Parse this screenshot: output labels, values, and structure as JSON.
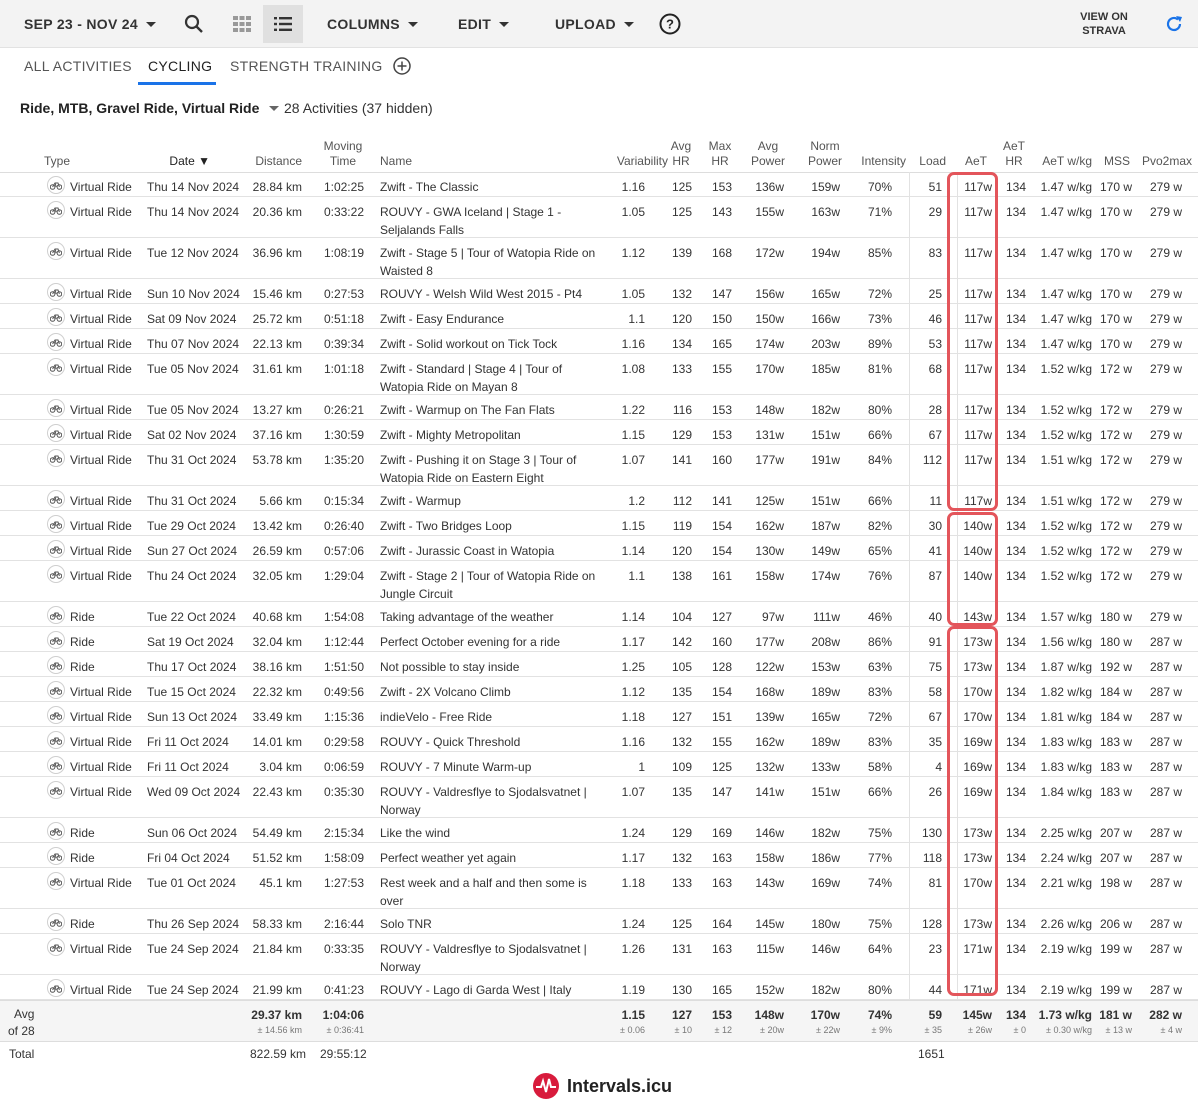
{
  "toolbar": {
    "date_range": "SEP 23 - NOV 24",
    "columns": "COLUMNS",
    "edit": "EDIT",
    "upload": "UPLOAD",
    "view_on_strava": "VIEW ON STRAVA",
    "active_view": "list"
  },
  "tabs": [
    "ALL ACTIVITIES",
    "CYCLING",
    "STRENGTH TRAINING"
  ],
  "active_tab": "CYCLING",
  "filter": {
    "types": "Ride, MTB, Gravel Ride, Virtual Ride",
    "count": "28 Activities (37 hidden)"
  },
  "columns": {
    "type": "Type",
    "date": "Date",
    "distance": "Distance",
    "moving_time": "Moving Time",
    "name": "Name",
    "variability": "Variability",
    "avg_hr": "Avg HR",
    "max_hr": "Max HR",
    "avg_power": "Avg Power",
    "norm_power": "Norm Power",
    "intensity": "Intensity",
    "load": "Load",
    "aet": "AeT",
    "aet_hr": "AeT HR",
    "aet_wkg": "AeT w/kg",
    "mss": "MSS",
    "pvo2max": "Pvo2max"
  },
  "rows": [
    {
      "type": "Virtual Ride",
      "date": "Thu 14 Nov 2024",
      "distance": "28.84 km",
      "time": "1:02:25",
      "name": "Zwift - The Classic",
      "var": "1.16",
      "avghr": "125",
      "maxhr": "153",
      "avgp": "136w",
      "normp": "159w",
      "int": "70%",
      "load": "51",
      "aet": "117w",
      "aethr": "134",
      "wkg": "1.47 w/kg",
      "mss": "170 w",
      "pvo": "279 w"
    },
    {
      "type": "Virtual Ride",
      "date": "Thu 14 Nov 2024",
      "distance": "20.36 km",
      "time": "0:33:22",
      "name": "ROUVY - GWA Iceland | Stage 1 - Seljalands Falls",
      "var": "1.05",
      "avghr": "125",
      "maxhr": "143",
      "avgp": "155w",
      "normp": "163w",
      "int": "71%",
      "load": "29",
      "aet": "117w",
      "aethr": "134",
      "wkg": "1.47 w/kg",
      "mss": "170 w",
      "pvo": "279 w"
    },
    {
      "type": "Virtual Ride",
      "date": "Tue 12 Nov 2024",
      "distance": "36.96 km",
      "time": "1:08:19",
      "name": "Zwift - Stage 5 | Tour of Watopia Ride on Waisted 8",
      "var": "1.12",
      "avghr": "139",
      "maxhr": "168",
      "avgp": "172w",
      "normp": "194w",
      "int": "85%",
      "load": "83",
      "aet": "117w",
      "aethr": "134",
      "wkg": "1.47 w/kg",
      "mss": "170 w",
      "pvo": "279 w"
    },
    {
      "type": "Virtual Ride",
      "date": "Sun 10 Nov 2024",
      "distance": "15.46 km",
      "time": "0:27:53",
      "name": "ROUVY - Welsh Wild West 2015 - Pt4",
      "var": "1.05",
      "avghr": "132",
      "maxhr": "147",
      "avgp": "156w",
      "normp": "165w",
      "int": "72%",
      "load": "25",
      "aet": "117w",
      "aethr": "134",
      "wkg": "1.47 w/kg",
      "mss": "170 w",
      "pvo": "279 w"
    },
    {
      "type": "Virtual Ride",
      "date": "Sat 09 Nov 2024",
      "distance": "25.72 km",
      "time": "0:51:18",
      "name": "Zwift - Easy Endurance",
      "var": "1.1",
      "avghr": "120",
      "maxhr": "150",
      "avgp": "150w",
      "normp": "166w",
      "int": "73%",
      "load": "46",
      "aet": "117w",
      "aethr": "134",
      "wkg": "1.47 w/kg",
      "mss": "170 w",
      "pvo": "279 w"
    },
    {
      "type": "Virtual Ride",
      "date": "Thu 07 Nov 2024",
      "distance": "22.13 km",
      "time": "0:39:34",
      "name": "Zwift - Solid workout on Tick Tock",
      "var": "1.16",
      "avghr": "134",
      "maxhr": "165",
      "avgp": "174w",
      "normp": "203w",
      "int": "89%",
      "load": "53",
      "aet": "117w",
      "aethr": "134",
      "wkg": "1.47 w/kg",
      "mss": "170 w",
      "pvo": "279 w"
    },
    {
      "type": "Virtual Ride",
      "date": "Tue 05 Nov 2024",
      "distance": "31.61 km",
      "time": "1:01:18",
      "name": "Zwift - Standard | Stage 4 | Tour of Watopia Ride on Mayan 8",
      "var": "1.08",
      "avghr": "133",
      "maxhr": "155",
      "avgp": "170w",
      "normp": "185w",
      "int": "81%",
      "load": "68",
      "aet": "117w",
      "aethr": "134",
      "wkg": "1.52 w/kg",
      "mss": "172 w",
      "pvo": "279 w"
    },
    {
      "type": "Virtual Ride",
      "date": "Tue 05 Nov 2024",
      "distance": "13.27 km",
      "time": "0:26:21",
      "name": "Zwift - Warmup on The Fan Flats",
      "var": "1.22",
      "avghr": "116",
      "maxhr": "153",
      "avgp": "148w",
      "normp": "182w",
      "int": "80%",
      "load": "28",
      "aet": "117w",
      "aethr": "134",
      "wkg": "1.52 w/kg",
      "mss": "172 w",
      "pvo": "279 w"
    },
    {
      "type": "Virtual Ride",
      "date": "Sat 02 Nov 2024",
      "distance": "37.16 km",
      "time": "1:30:59",
      "name": "Zwift - Mighty Metropolitan",
      "var": "1.15",
      "avghr": "129",
      "maxhr": "153",
      "avgp": "131w",
      "normp": "151w",
      "int": "66%",
      "load": "67",
      "aet": "117w",
      "aethr": "134",
      "wkg": "1.52 w/kg",
      "mss": "172 w",
      "pvo": "279 w"
    },
    {
      "type": "Virtual Ride",
      "date": "Thu 31 Oct 2024",
      "distance": "53.78 km",
      "time": "1:35:20",
      "name": "Zwift - Pushing it on Stage 3 | Tour of Watopia Ride on Eastern Eight",
      "var": "1.07",
      "avghr": "141",
      "maxhr": "160",
      "avgp": "177w",
      "normp": "191w",
      "int": "84%",
      "load": "112",
      "aet": "117w",
      "aethr": "134",
      "wkg": "1.51 w/kg",
      "mss": "172 w",
      "pvo": "279 w"
    },
    {
      "type": "Virtual Ride",
      "date": "Thu 31 Oct 2024",
      "distance": "5.66 km",
      "time": "0:15:34",
      "name": "Zwift - Warmup",
      "var": "1.2",
      "avghr": "112",
      "maxhr": "141",
      "avgp": "125w",
      "normp": "151w",
      "int": "66%",
      "load": "11",
      "aet": "117w",
      "aethr": "134",
      "wkg": "1.51 w/kg",
      "mss": "172 w",
      "pvo": "279 w"
    },
    {
      "type": "Virtual Ride",
      "date": "Tue 29 Oct 2024",
      "distance": "13.42 km",
      "time": "0:26:40",
      "name": "Zwift - Two Bridges Loop",
      "var": "1.15",
      "avghr": "119",
      "maxhr": "154",
      "avgp": "162w",
      "normp": "187w",
      "int": "82%",
      "load": "30",
      "aet": "140w",
      "aethr": "134",
      "wkg": "1.52 w/kg",
      "mss": "172 w",
      "pvo": "279 w"
    },
    {
      "type": "Virtual Ride",
      "date": "Sun 27 Oct 2024",
      "distance": "26.59 km",
      "time": "0:57:06",
      "name": "Zwift - Jurassic Coast in Watopia",
      "var": "1.14",
      "avghr": "120",
      "maxhr": "154",
      "avgp": "130w",
      "normp": "149w",
      "int": "65%",
      "load": "41",
      "aet": "140w",
      "aethr": "134",
      "wkg": "1.52 w/kg",
      "mss": "172 w",
      "pvo": "279 w"
    },
    {
      "type": "Virtual Ride",
      "date": "Thu 24 Oct 2024",
      "distance": "32.05 km",
      "time": "1:29:04",
      "name": "Zwift - Stage 2 | Tour of Watopia Ride on Jungle Circuit",
      "var": "1.1",
      "avghr": "138",
      "maxhr": "161",
      "avgp": "158w",
      "normp": "174w",
      "int": "76%",
      "load": "87",
      "aet": "140w",
      "aethr": "134",
      "wkg": "1.52 w/kg",
      "mss": "172 w",
      "pvo": "279 w"
    },
    {
      "type": "Ride",
      "date": "Tue 22 Oct 2024",
      "distance": "40.68 km",
      "time": "1:54:08",
      "name": "Taking advantage of the weather",
      "var": "1.14",
      "avghr": "104",
      "maxhr": "127",
      "avgp": "97w",
      "normp": "111w",
      "int": "46%",
      "load": "40",
      "aet": "143w",
      "aethr": "134",
      "wkg": "1.57 w/kg",
      "mss": "180 w",
      "pvo": "279 w"
    },
    {
      "type": "Ride",
      "date": "Sat 19 Oct 2024",
      "distance": "32.04 km",
      "time": "1:12:44",
      "name": "Perfect October evening for a ride",
      "var": "1.17",
      "avghr": "142",
      "maxhr": "160",
      "avgp": "177w",
      "normp": "208w",
      "int": "86%",
      "load": "91",
      "aet": "173w",
      "aethr": "134",
      "wkg": "1.56 w/kg",
      "mss": "180 w",
      "pvo": "287 w"
    },
    {
      "type": "Ride",
      "date": "Thu 17 Oct 2024",
      "distance": "38.16 km",
      "time": "1:51:50",
      "name": "Not possible to stay inside",
      "var": "1.25",
      "avghr": "105",
      "maxhr": "128",
      "avgp": "122w",
      "normp": "153w",
      "int": "63%",
      "load": "75",
      "aet": "173w",
      "aethr": "134",
      "wkg": "1.87 w/kg",
      "mss": "192 w",
      "pvo": "287 w"
    },
    {
      "type": "Virtual Ride",
      "date": "Tue 15 Oct 2024",
      "distance": "22.32 km",
      "time": "0:49:56",
      "name": "Zwift - 2X Volcano Climb",
      "var": "1.12",
      "avghr": "135",
      "maxhr": "154",
      "avgp": "168w",
      "normp": "189w",
      "int": "83%",
      "load": "58",
      "aet": "170w",
      "aethr": "134",
      "wkg": "1.82 w/kg",
      "mss": "184 w",
      "pvo": "287 w"
    },
    {
      "type": "Virtual Ride",
      "date": "Sun 13 Oct 2024",
      "distance": "33.49 km",
      "time": "1:15:36",
      "name": "indieVelo - Free Ride",
      "var": "1.18",
      "avghr": "127",
      "maxhr": "151",
      "avgp": "139w",
      "normp": "165w",
      "int": "72%",
      "load": "67",
      "aet": "170w",
      "aethr": "134",
      "wkg": "1.81 w/kg",
      "mss": "184 w",
      "pvo": "287 w"
    },
    {
      "type": "Virtual Ride",
      "date": "Fri 11 Oct 2024",
      "distance": "14.01 km",
      "time": "0:29:58",
      "name": "ROUVY - Quick Threshold",
      "var": "1.16",
      "avghr": "132",
      "maxhr": "155",
      "avgp": "162w",
      "normp": "189w",
      "int": "83%",
      "load": "35",
      "aet": "169w",
      "aethr": "134",
      "wkg": "1.83 w/kg",
      "mss": "183 w",
      "pvo": "287 w"
    },
    {
      "type": "Virtual Ride",
      "date": "Fri 11 Oct 2024",
      "distance": "3.04 km",
      "time": "0:06:59",
      "name": "ROUVY - 7 Minute Warm-up",
      "var": "1",
      "avghr": "109",
      "maxhr": "125",
      "avgp": "132w",
      "normp": "133w",
      "int": "58%",
      "load": "4",
      "aet": "169w",
      "aethr": "134",
      "wkg": "1.83 w/kg",
      "mss": "183 w",
      "pvo": "287 w"
    },
    {
      "type": "Virtual Ride",
      "date": "Wed 09 Oct 2024",
      "distance": "22.43 km",
      "time": "0:35:30",
      "name": "ROUVY - Valdresflye to Sjodalsvatnet | Norway",
      "var": "1.07",
      "avghr": "135",
      "maxhr": "147",
      "avgp": "141w",
      "normp": "151w",
      "int": "66%",
      "load": "26",
      "aet": "169w",
      "aethr": "134",
      "wkg": "1.84 w/kg",
      "mss": "183 w",
      "pvo": "287 w"
    },
    {
      "type": "Ride",
      "date": "Sun 06 Oct 2024",
      "distance": "54.49 km",
      "time": "2:15:34",
      "name": "Like the wind",
      "var": "1.24",
      "avghr": "129",
      "maxhr": "169",
      "avgp": "146w",
      "normp": "182w",
      "int": "75%",
      "load": "130",
      "aet": "173w",
      "aethr": "134",
      "wkg": "2.25 w/kg",
      "mss": "207 w",
      "pvo": "287 w"
    },
    {
      "type": "Ride",
      "date": "Fri 04 Oct 2024",
      "distance": "51.52 km",
      "time": "1:58:09",
      "name": "Perfect weather yet again",
      "var": "1.17",
      "avghr": "132",
      "maxhr": "163",
      "avgp": "158w",
      "normp": "186w",
      "int": "77%",
      "load": "118",
      "aet": "173w",
      "aethr": "134",
      "wkg": "2.24 w/kg",
      "mss": "207 w",
      "pvo": "287 w"
    },
    {
      "type": "Virtual Ride",
      "date": "Tue 01 Oct 2024",
      "distance": "45.1 km",
      "time": "1:27:53",
      "name": "Rest week and a half and then some is over",
      "var": "1.18",
      "avghr": "133",
      "maxhr": "163",
      "avgp": "143w",
      "normp": "169w",
      "int": "74%",
      "load": "81",
      "aet": "170w",
      "aethr": "134",
      "wkg": "2.21 w/kg",
      "mss": "198 w",
      "pvo": "287 w"
    },
    {
      "type": "Ride",
      "date": "Thu 26 Sep 2024",
      "distance": "58.33 km",
      "time": "2:16:44",
      "name": "Solo TNR",
      "var": "1.24",
      "avghr": "125",
      "maxhr": "164",
      "avgp": "145w",
      "normp": "180w",
      "int": "75%",
      "load": "128",
      "aet": "173w",
      "aethr": "134",
      "wkg": "2.26 w/kg",
      "mss": "206 w",
      "pvo": "287 w"
    },
    {
      "type": "Virtual Ride",
      "date": "Tue 24 Sep 2024",
      "distance": "21.84 km",
      "time": "0:33:35",
      "name": "ROUVY - Valdresflye to Sjodalsvatnet | Norway",
      "var": "1.26",
      "avghr": "131",
      "maxhr": "163",
      "avgp": "115w",
      "normp": "146w",
      "int": "64%",
      "load": "23",
      "aet": "171w",
      "aethr": "134",
      "wkg": "2.19 w/kg",
      "mss": "199 w",
      "pvo": "287 w"
    },
    {
      "type": "Virtual Ride",
      "date": "Tue 24 Sep 2024",
      "distance": "21.99 km",
      "time": "0:41:23",
      "name": "ROUVY - Lago di Garda West | Italy",
      "var": "1.19",
      "avghr": "130",
      "maxhr": "165",
      "avgp": "152w",
      "normp": "182w",
      "int": "80%",
      "load": "44",
      "aet": "171w",
      "aethr": "134",
      "wkg": "2.19 w/kg",
      "mss": "199 w",
      "pvo": "287 w"
    }
  ],
  "avg": {
    "label": "Avg",
    "label2": "of 28",
    "distance": "29.37 km",
    "distance_sd": "± 14.56 km",
    "time": "1:04:06",
    "time_sd": "± 0:36:41",
    "var": "1.15",
    "var_sd": "± 0.06",
    "avghr": "127",
    "avghr_sd": "± 10",
    "maxhr": "153",
    "maxhr_sd": "± 12",
    "avgp": "148w",
    "avgp_sd": "± 20w",
    "normp": "170w",
    "normp_sd": "± 22w",
    "int": "74%",
    "int_sd": "± 9%",
    "load": "59",
    "load_sd": "± 35",
    "aet": "145w",
    "aet_sd": "± 26w",
    "aethr": "134",
    "aethr_sd": "± 0",
    "wkg": "1.73 w/kg",
    "wkg_sd": "± 0.30 w/kg",
    "mss": "181 w",
    "mss_sd": "± 13 w",
    "pvo": "282 w",
    "pvo_sd": "± 4 w"
  },
  "total": {
    "label": "Total",
    "distance": "822.59 km",
    "time": "29:55:12",
    "load": "1651"
  },
  "brand": "Intervals.icu",
  "colors": {
    "highlight": "#e3555b",
    "accent": "#1a73e8",
    "brand": "#d81b3c"
  }
}
